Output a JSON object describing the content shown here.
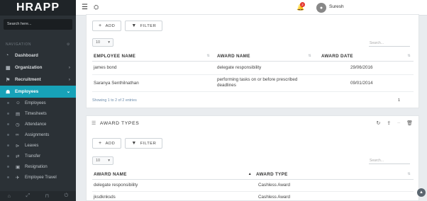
{
  "brand": "HRAPP",
  "sidebar": {
    "search_placeholder": "Search here...",
    "nav_header": "NAVIGATION",
    "items": [
      {
        "label": "Dashboard"
      },
      {
        "label": "Organization"
      },
      {
        "label": "Recruitment"
      },
      {
        "label": "Employees"
      }
    ],
    "subitems": [
      {
        "label": "Employees"
      },
      {
        "label": "Timesheets"
      },
      {
        "label": "Attendance"
      },
      {
        "label": "Assignments"
      },
      {
        "label": "Leaves"
      },
      {
        "label": "Transfer"
      },
      {
        "label": "Resignation"
      },
      {
        "label": "Employee Travel"
      }
    ]
  },
  "topbar": {
    "notification_count": "2",
    "user_name": "Suresh"
  },
  "awards_panel": {
    "add_label": "ADD",
    "filter_label": "FILTER",
    "page_length": "10",
    "search_placeholder": "Search...",
    "columns": [
      "EMPLOYEE NAME",
      "AWARD NAME",
      "AWARD DATE"
    ],
    "rows": [
      [
        "james bond",
        "delegate responsibility",
        "29/06/2016"
      ],
      [
        "Saranya Senthilnathan",
        "performing tasks on or before prescribed deadlines",
        "09/01/2014"
      ]
    ],
    "info": "Showing 1 to 2 of 2 entries",
    "page": "1"
  },
  "award_types_panel": {
    "title": "AWARD TYPES",
    "add_label": "ADD",
    "filter_label": "FILTER",
    "page_length": "10",
    "search_placeholder": "Search...",
    "columns": [
      "AWARD NAME",
      "AWARD TYPE"
    ],
    "rows": [
      [
        "delegate responsibility",
        "Cashless Award"
      ],
      [
        "jksdknksds",
        "Cashless Award"
      ]
    ]
  }
}
